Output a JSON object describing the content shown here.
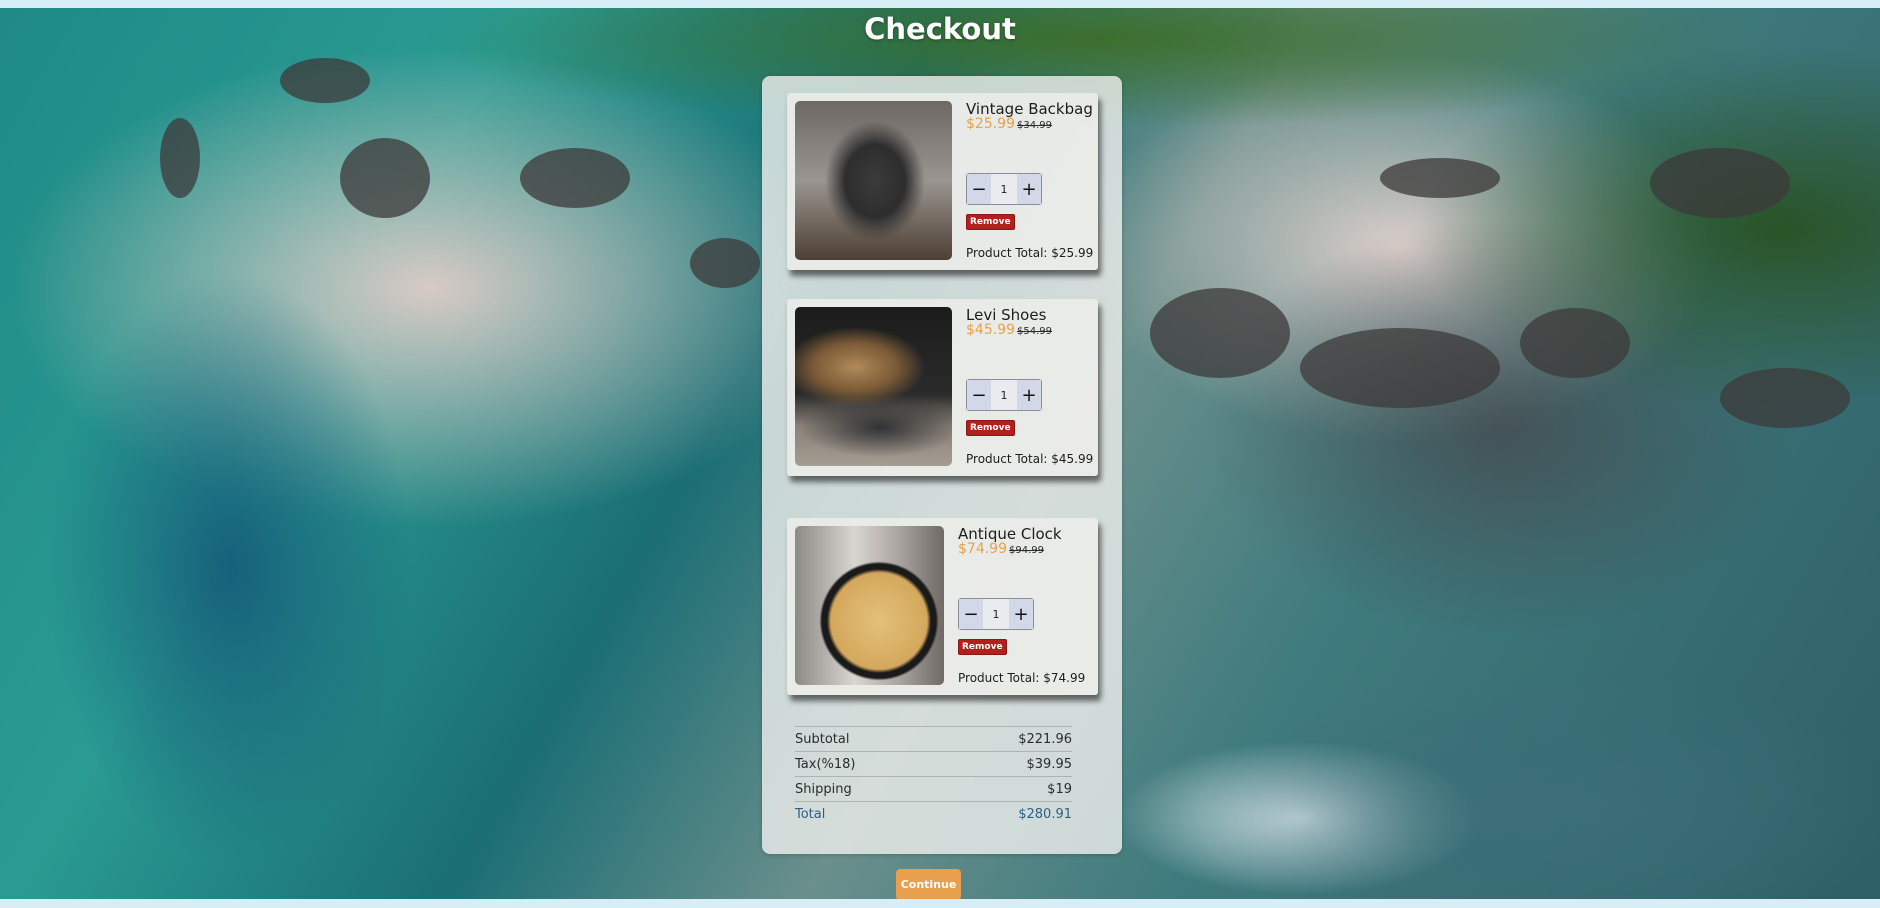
{
  "page": {
    "title": "Checkout"
  },
  "products": [
    {
      "name": "Vintage Backbag",
      "price": "$25.99",
      "old_price": "$34.99",
      "quantity": "1",
      "remove_label": "Remove",
      "total_label": "Product Total: $25.99",
      "image_icon": "backpack-photo"
    },
    {
      "name": "Levi Shoes",
      "price": "$45.99",
      "old_price": "$54.99",
      "quantity": "1",
      "remove_label": "Remove",
      "total_label": "Product Total: $45.99",
      "image_icon": "shoe-photo"
    },
    {
      "name": "Antique Clock",
      "price": "$74.99",
      "old_price": "$94.99",
      "quantity": "1",
      "remove_label": "Remove",
      "total_label": "Product Total: $74.99",
      "image_icon": "clock-photo"
    }
  ],
  "stepper": {
    "minus": "−",
    "plus": "+"
  },
  "summary": [
    {
      "label": "Subtotal",
      "value": "$221.96"
    },
    {
      "label": "Tax(%18)",
      "value": "$39.95"
    },
    {
      "label": "Shipping",
      "value": "$19"
    },
    {
      "label": "Total",
      "value": "$280.91"
    }
  ],
  "continue_label": "Continue",
  "colors": {
    "accent": "#e9a04e",
    "remove": "#b0201d",
    "price": "#e8a24a",
    "total": "#2b5f8a"
  }
}
